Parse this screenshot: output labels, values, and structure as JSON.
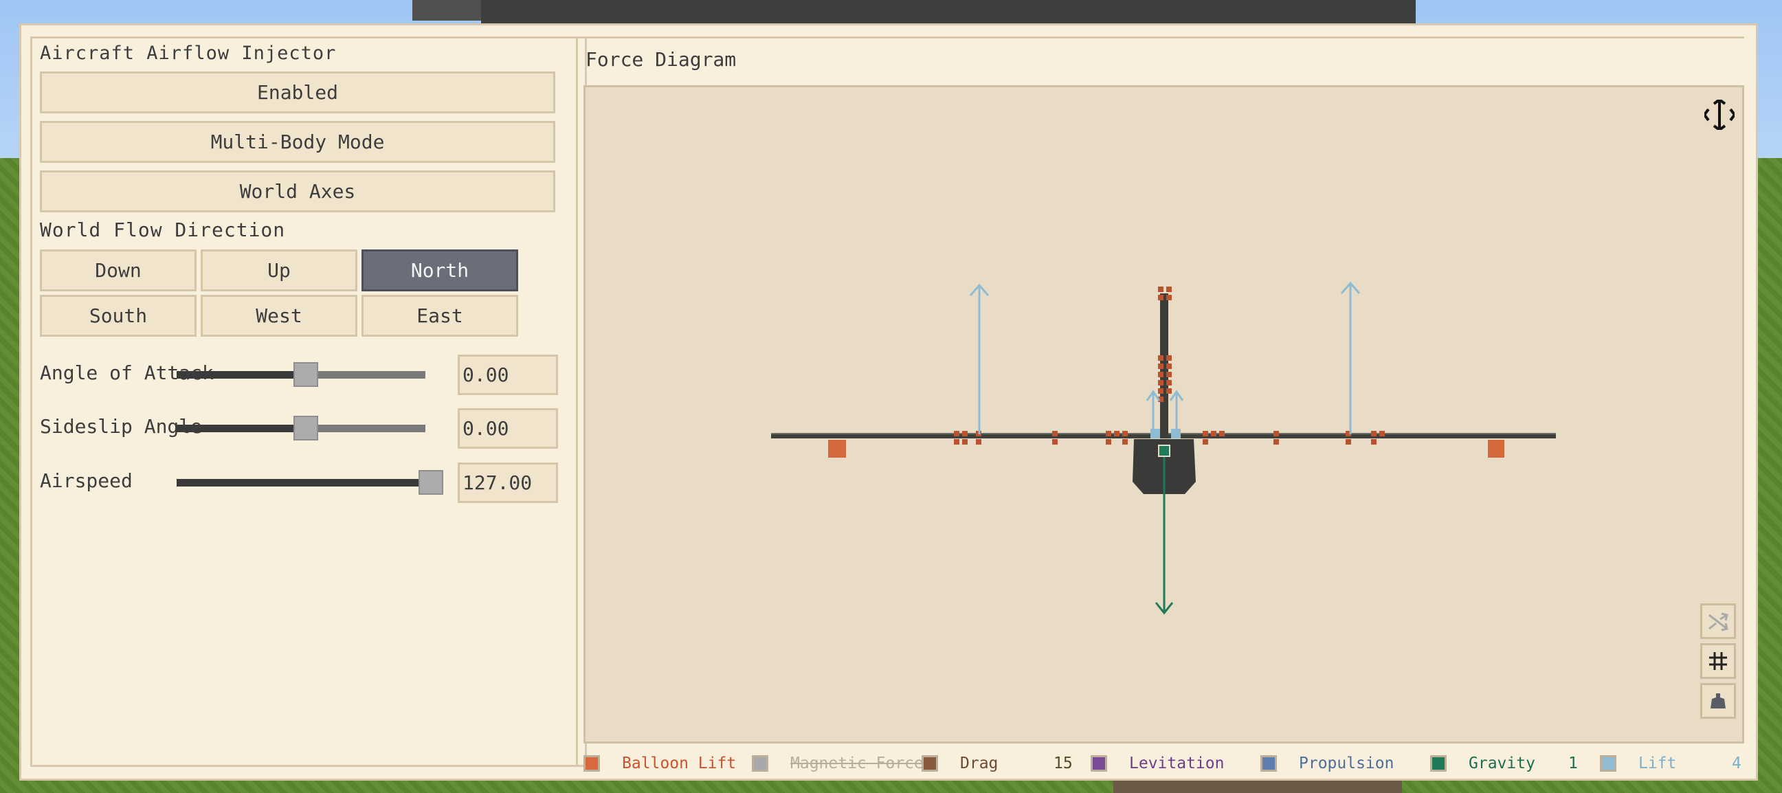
{
  "left_panel": {
    "title": "Aircraft Airflow Injector",
    "buttons": {
      "enabled": "Enabled",
      "mode": "Multi-Body Mode",
      "axes": "World Axes"
    },
    "flow_direction": {
      "label": "World Flow Direction",
      "options": [
        "Down",
        "Up",
        "North",
        "South",
        "West",
        "East"
      ],
      "selected": "North"
    },
    "sliders": {
      "aoa": {
        "label": "Angle of Attack",
        "value": "0.00",
        "fraction": 0.5
      },
      "sideslip": {
        "label": "Sideslip Angle",
        "value": "0.00",
        "fraction": 0.5
      },
      "airspeed": {
        "label": "Airspeed",
        "value": "127.00",
        "fraction": 1.0
      }
    }
  },
  "right_panel": {
    "title": "Force Diagram",
    "icons": {
      "move": "move-arrows-icon",
      "shuffle": "shuffle-icon",
      "grid": "grid-crosshair-icon",
      "bell": "weight-icon"
    },
    "legend": [
      {
        "label": "Balloon Lift",
        "color": "#d9683f",
        "text_color": "#c9542e",
        "count": "",
        "disabled": false
      },
      {
        "label": "Magnetic Force",
        "color": "#a8a8a8",
        "text_color": "#b8ad9c",
        "count": "",
        "disabled": true
      },
      {
        "label": "Drag",
        "color": "#8a5a3c",
        "text_color": "#6e4a2e",
        "count": "15",
        "disabled": false
      },
      {
        "label": "Levitation",
        "color": "#7a4b96",
        "text_color": "#6f3d8a",
        "count": "",
        "disabled": false
      },
      {
        "label": "Propulsion",
        "color": "#5e7fae",
        "text_color": "#4f6f9a",
        "count": "",
        "disabled": false
      },
      {
        "label": "Gravity",
        "color": "#1f7a5a",
        "text_color": "#1d6e50",
        "count": "1",
        "disabled": false
      },
      {
        "label": "Lift",
        "color": "#8fbcd3",
        "text_color": "#7fb0c8",
        "count": "4",
        "disabled": false
      }
    ]
  }
}
